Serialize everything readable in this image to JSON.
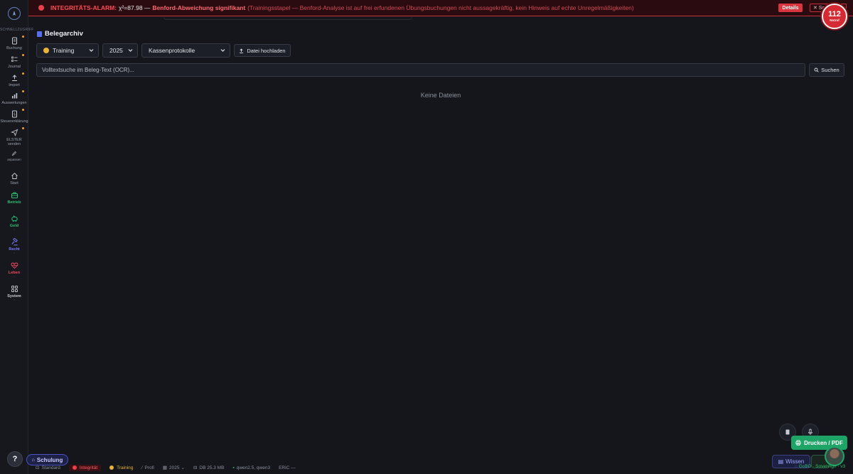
{
  "sidebar": {
    "quick_label": "SCHNELLZUGRIFF",
    "quick_items": [
      {
        "label": "Buchung"
      },
      {
        "label": "Journal"
      },
      {
        "label": "Import"
      },
      {
        "label": "Auswertungen"
      },
      {
        "label": "Steuererklärung"
      },
      {
        "label": "ELSTER senden"
      },
      {
        "label": "anpassen"
      }
    ],
    "sections": [
      {
        "label": "Start"
      },
      {
        "label": "Betrieb"
      },
      {
        "label": "Geld",
        "sub": "›"
      },
      {
        "label": "Recht",
        "sub": "›"
      },
      {
        "label": "Leben",
        "sub": "›"
      },
      {
        "label": "System",
        "sub": "›"
      }
    ]
  },
  "alarm": {
    "title": "INTEGRITÄTS-ALARM:",
    "chi": "χ²=87.98 —",
    "significance": "Benford-Abweichung signifikant",
    "description": "(Trainingsstapel — Benford-Analyse ist auf frei erfundenen Übungsbuchungen nicht aussagekräftig, kein Hinweis auf echte Unregelmäßigkeiten)",
    "details_label": "Details",
    "close_label": "✕ Sc"
  },
  "notruf": {
    "number": "112",
    "label": "Notruf"
  },
  "page": {
    "title": "Belegarchiv",
    "filters": {
      "mode": "Training",
      "year": "2025",
      "category": "Kassenprotokolle"
    },
    "upload_label": "Datei hochladen",
    "search_placeholder": "Volltextsuche im Beleg-Text (OCR)...",
    "search_label": "Suchen",
    "empty_text": "Keine Dateien"
  },
  "floating": {
    "print_label": "Drucken / PDF",
    "wissen_label": "Wissen",
    "gobd_label": "GoBD · Sovereign · v3",
    "help_label": "?",
    "schulung_label": "Schulung"
  },
  "statusbar": {
    "standard": "Standard",
    "integritaet": "Integrität",
    "training": "Training",
    "profi": "Profi",
    "year": "2025",
    "db": "DB 25.3 MB",
    "models": "qwen2.5, qwen3",
    "eric": "ERiC —"
  },
  "colors": {
    "background": "#14161c",
    "alarm": "#ff4a55",
    "accent_green": "#1fa468",
    "accent_indigo": "#5a6cf0"
  }
}
